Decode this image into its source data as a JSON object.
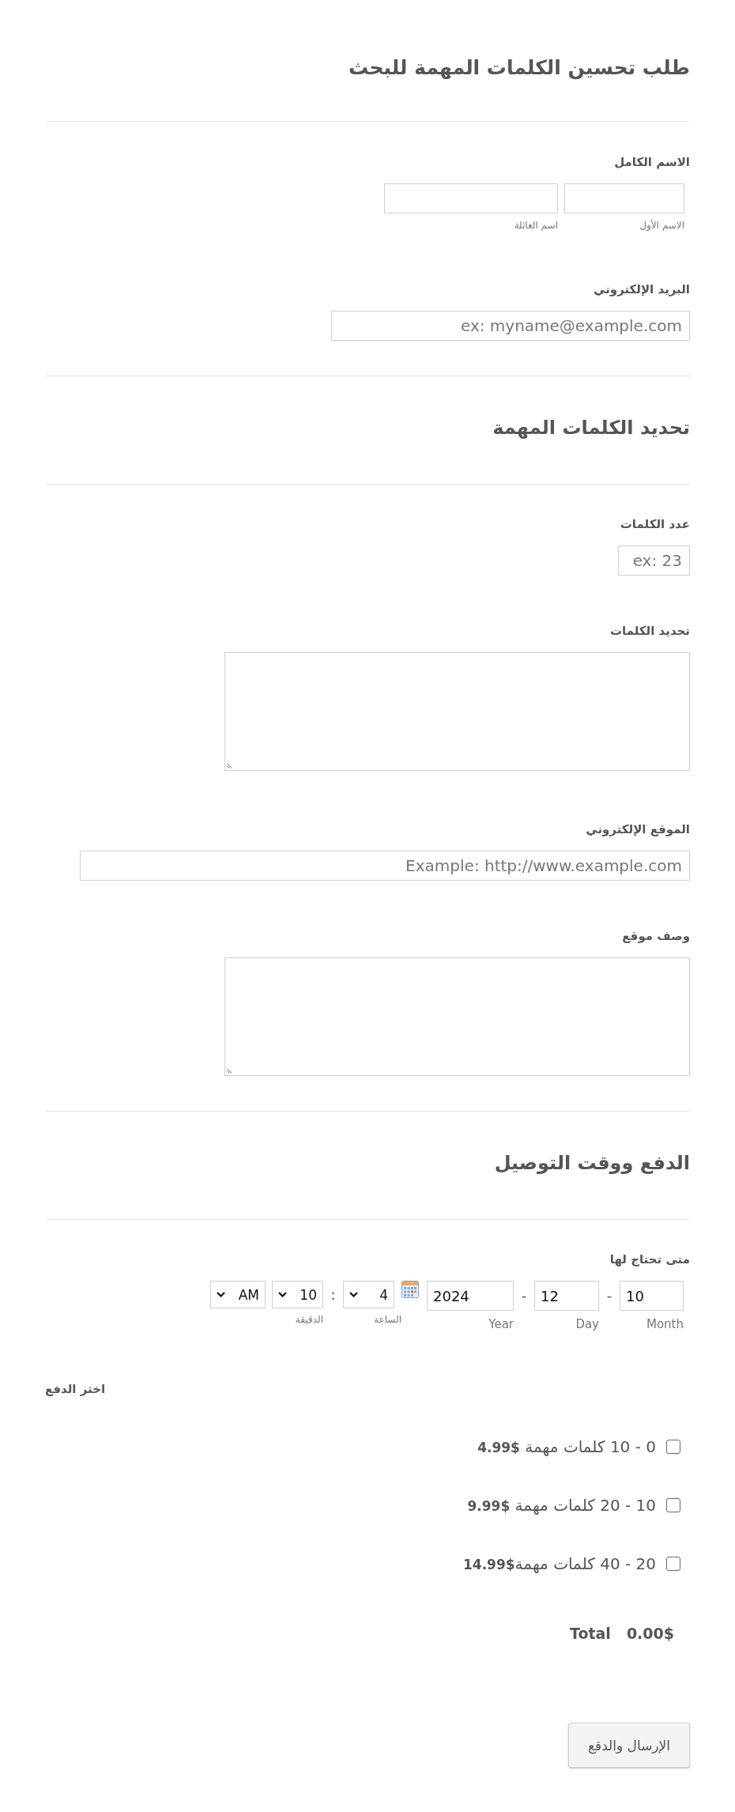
{
  "title": "طلب تحسين الكلمات المهمة للبحث",
  "fields": [
    {
      "kind": "full_name",
      "label": "الاسم الكامل",
      "parts": [
        {
          "sublabel": "الاسم الأول"
        },
        {
          "sublabel": "اسم العائلة"
        }
      ]
    },
    {
      "kind": "email",
      "label": "البريد الإلكتروني",
      "placeholder": "ex: myname@example.com"
    },
    {
      "kind": "heading",
      "text": "تحديد الكلمات المهمة"
    },
    {
      "kind": "number",
      "label": "عدد الكلمات",
      "placeholder": "ex: 23"
    },
    {
      "kind": "textarea",
      "label": "تحديد الكلمات"
    },
    {
      "kind": "url",
      "label": "الموقع الإلكتروني",
      "placeholder": "Example: http://www.example.com"
    },
    {
      "kind": "textarea",
      "label": "وصف موقع"
    },
    {
      "kind": "heading",
      "text": "الدفع ووقت التوصيل"
    },
    {
      "kind": "datetime",
      "label": "متى تحتاج لها",
      "date": [
        {
          "value": "10",
          "sublabel": "Month"
        },
        {
          "separator": "-",
          "value": "12",
          "sublabel": "Day"
        },
        {
          "separator": "-",
          "value": "2024",
          "sublabel": "Year"
        }
      ],
      "time": [
        {
          "value": "4",
          "sublabel": "الساعة"
        },
        {
          "separator": ":",
          "value": "10",
          "sublabel": "الدقيقة"
        },
        {
          "value": "AM"
        }
      ]
    },
    {
      "kind": "payment",
      "label": "اختر الدفع",
      "options": [
        {
          "text": "0 - 10 كلمات مهمة **4.99$**",
          "checked": false
        },
        {
          "text": "10 - 20 كلمات مهمة **9.99$**",
          "checked": false
        },
        {
          "text": "20 - 40 كلمات مهمة**14.99$**",
          "checked": false
        }
      ],
      "total_label": "Total",
      "total": "0.00$"
    }
  ],
  "submit_button": {
    "label": "الإرسال والدقع"
  }
}
